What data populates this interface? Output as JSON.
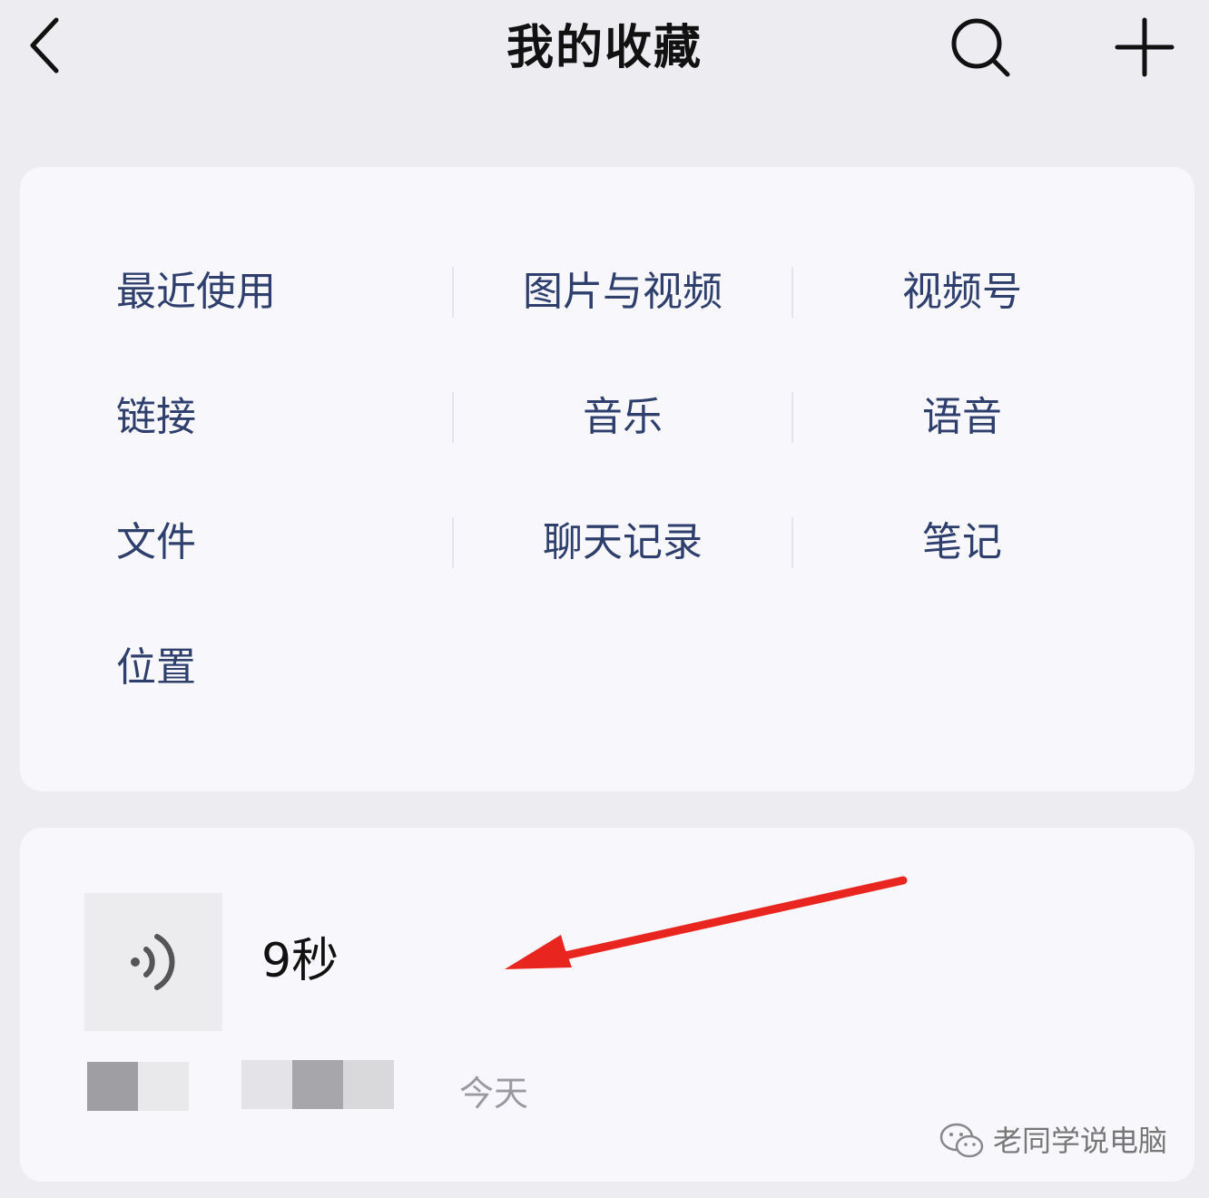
{
  "header": {
    "title": "我的收藏",
    "back_icon": "chevron-left-icon",
    "search_icon": "search-icon",
    "add_icon": "plus-icon"
  },
  "categories": [
    {
      "label": "最近使用"
    },
    {
      "label": "图片与视频"
    },
    {
      "label": "视频号"
    },
    {
      "label": "链接"
    },
    {
      "label": "音乐"
    },
    {
      "label": "语音"
    },
    {
      "label": "文件"
    },
    {
      "label": "聊天记录"
    },
    {
      "label": "笔记"
    },
    {
      "label": "位置"
    }
  ],
  "item": {
    "type_icon": "voice-icon",
    "duration": "9秒",
    "date": "今天"
  },
  "watermark": {
    "text": "老同学说电脑"
  },
  "colors": {
    "background": "#ededf1",
    "card": "#f8f8fc",
    "category_text": "#2e3f6e",
    "annotation_arrow": "#e8261f"
  }
}
